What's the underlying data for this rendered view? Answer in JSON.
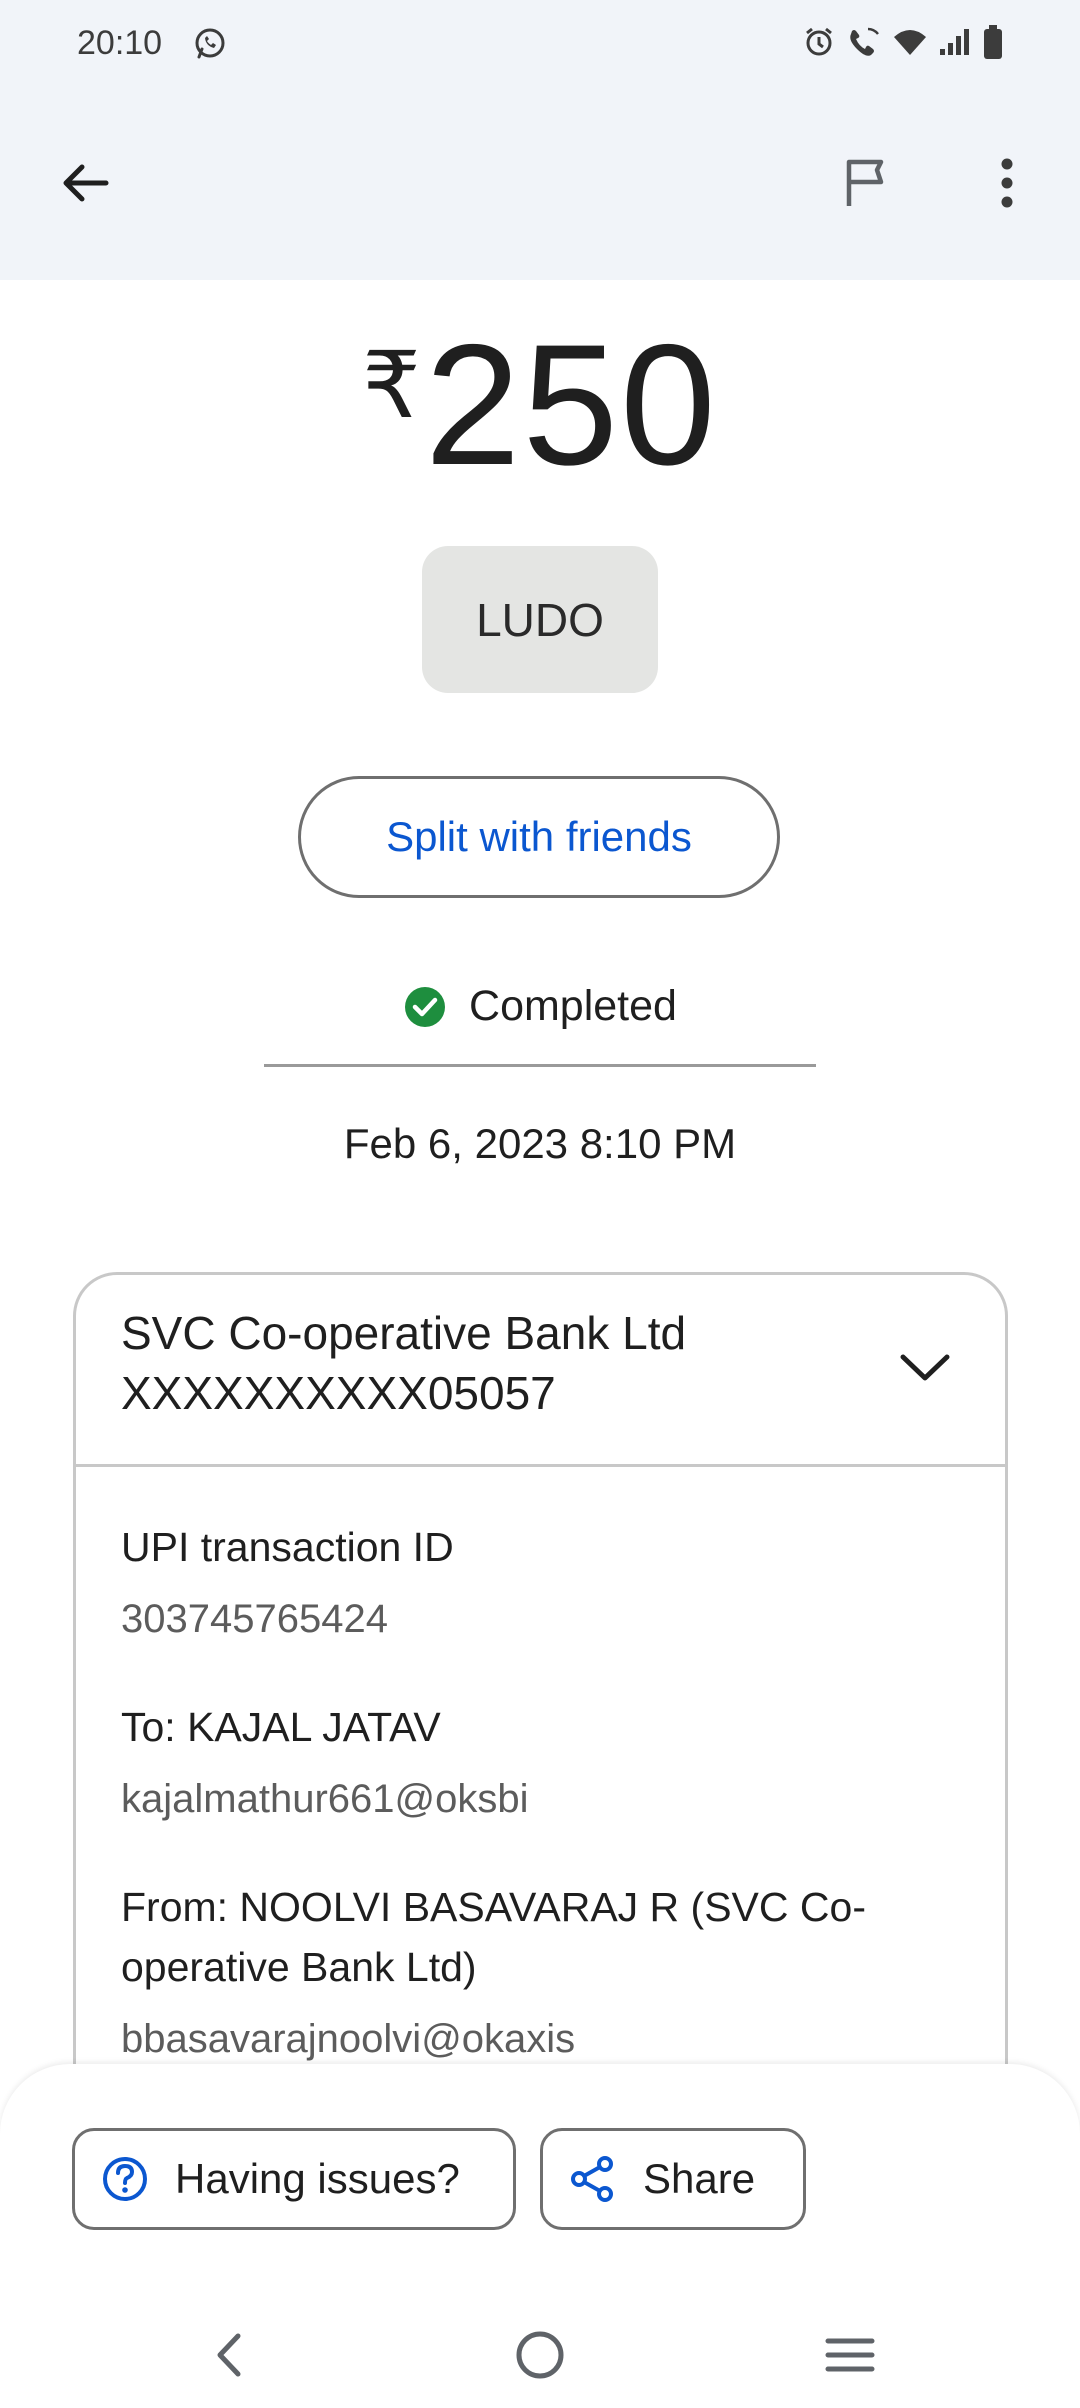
{
  "status_bar": {
    "time": "20:10",
    "icons": [
      "whatsapp-icon",
      "alarm-icon",
      "wifi-call-icon",
      "wifi-icon",
      "signal-icon",
      "battery-icon"
    ]
  },
  "app_bar": {
    "back_icon": "arrow-left-icon",
    "flag_icon": "flag-icon",
    "more_icon": "more-vert-icon"
  },
  "transaction": {
    "currency_symbol": "₹",
    "amount": "250",
    "note": "LUDO",
    "split_label": "Split with friends",
    "status": "Completed",
    "datetime": "Feb 6, 2023 8:10 PM"
  },
  "details_card": {
    "bank_line1": "SVC Co-operative Bank Ltd",
    "bank_line2": "XXXXXXXXXX05057",
    "upi_label": "UPI transaction ID",
    "upi_id": "303745765424",
    "to_label": "To: KAJAL  JATAV",
    "to_vpa": "kajalmathur661@oksbi",
    "from_label_line1": "From: NOOLVI BASAVARAJ R (SVC Co-",
    "from_label_line2": "operative Bank Ltd)",
    "from_vpa": "bbasavarajnoolvi@okaxis"
  },
  "actions": {
    "issues_label": "Having issues?",
    "share_label": "Share"
  },
  "colors": {
    "accent_blue": "#0b57d0",
    "success_green": "#1e8e3e",
    "top_background": "#f1f4f9"
  }
}
